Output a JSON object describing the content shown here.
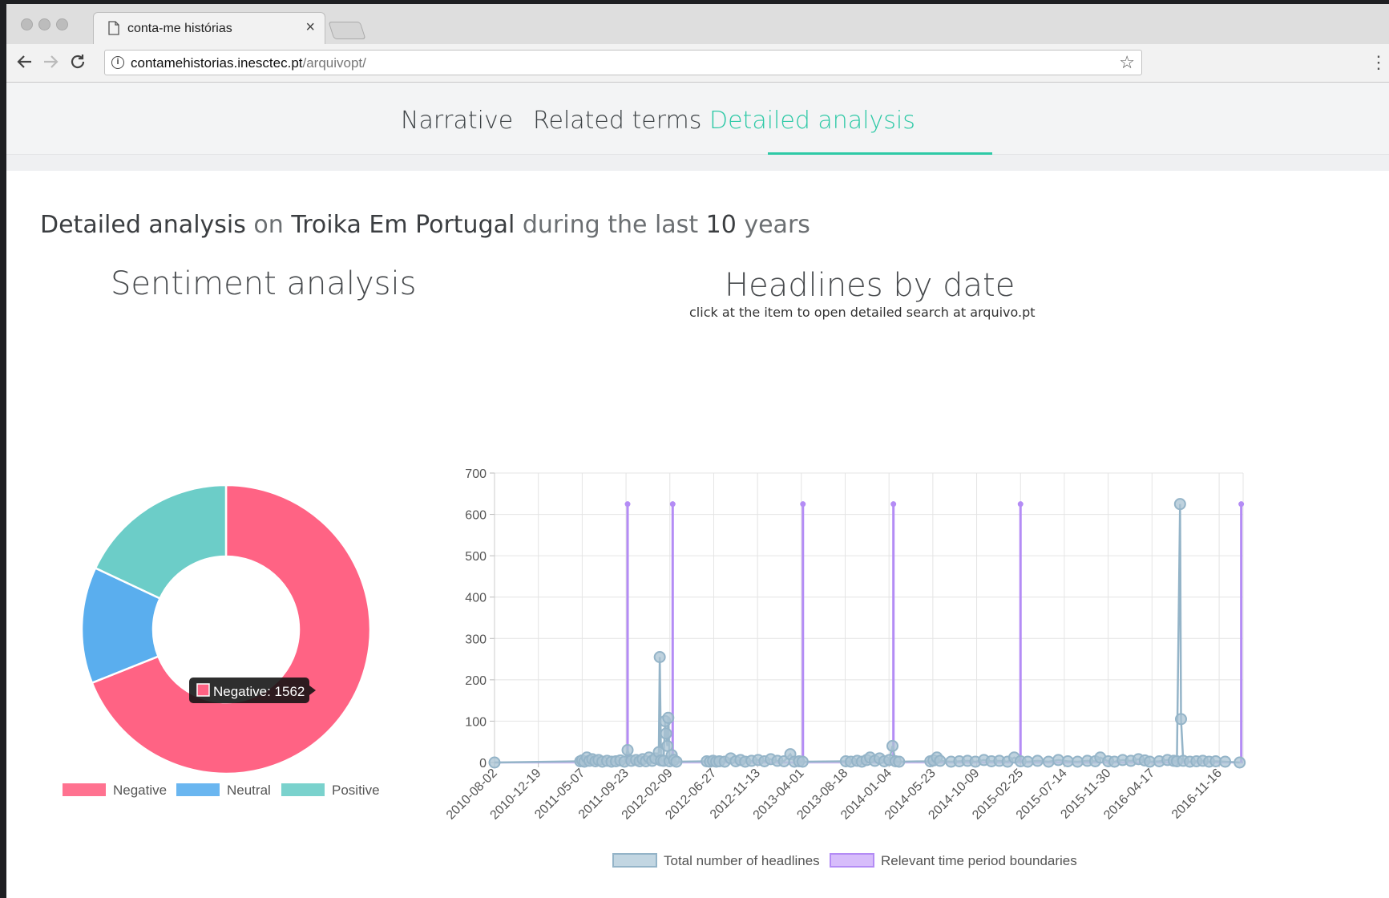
{
  "browser": {
    "tab_title": "conta-me histórias",
    "close_glyph": "×",
    "url_host": "contamehistorias.inesctec.pt",
    "url_path": "/arquivopt/"
  },
  "nav": {
    "tabs": [
      {
        "label": "Narrative",
        "active": false
      },
      {
        "label": "Related terms",
        "active": false
      },
      {
        "label": "Detailed analysis",
        "active": true
      }
    ],
    "active_color": "#2ec9a6"
  },
  "summary": {
    "p1": "Detailed analysis",
    "p2": " on ",
    "p3": "Troika Em Portugal",
    "p4": " during the last ",
    "p5": "10",
    "p6": " years"
  },
  "sentiment": {
    "title": "Sentiment analysis",
    "tooltip": "Negative: 1562",
    "chart_data": {
      "type": "pie",
      "donut": true,
      "labels": [
        "Negative",
        "Neutral",
        "Positive"
      ],
      "values": [
        1562,
        295,
        408
      ],
      "colors": [
        "#ff6384",
        "#5aaeee",
        "#6ccdc8"
      ],
      "legend_position": "bottom"
    }
  },
  "headlines": {
    "title": "Headlines by date",
    "subtitle": "click at the item to open detailed search at arquivo.pt",
    "chart_data": {
      "type": "line",
      "ylim": [
        0,
        700
      ],
      "yticks": [
        0,
        100,
        200,
        300,
        400,
        500,
        600,
        700
      ],
      "xlim": [
        "2010-08-02",
        "2017-01-31"
      ],
      "xticks": [
        "2010-08-02",
        "2010-12-19",
        "2011-05-07",
        "2011-09-23",
        "2012-02-09",
        "2012-06-27",
        "2012-11-13",
        "2013-04-01",
        "2013-08-18",
        "2014-01-04",
        "2014-05-23",
        "2014-10-09",
        "2015-02-25",
        "2015-07-14",
        "2015-11-30",
        "2016-04-17",
        "2016-11-16"
      ],
      "grid": true,
      "legend_position": "bottom",
      "series": [
        {
          "name": "Total number of headlines",
          "color": "#94b4c8",
          "points": [
            [
              "2010-08-02",
              0
            ],
            [
              "2011-05-01",
              3
            ],
            [
              "2011-05-07",
              5
            ],
            [
              "2011-05-14",
              2
            ],
            [
              "2011-05-22",
              12
            ],
            [
              "2011-05-30",
              4
            ],
            [
              "2011-06-08",
              8
            ],
            [
              "2011-06-18",
              3
            ],
            [
              "2011-06-28",
              6
            ],
            [
              "2011-07-10",
              2
            ],
            [
              "2011-07-25",
              4
            ],
            [
              "2011-08-08",
              2
            ],
            [
              "2011-08-22",
              3
            ],
            [
              "2011-09-05",
              5
            ],
            [
              "2011-09-18",
              2
            ],
            [
              "2011-09-28",
              30
            ],
            [
              "2011-10-10",
              4
            ],
            [
              "2011-10-25",
              6
            ],
            [
              "2011-11-05",
              3
            ],
            [
              "2011-11-15",
              8
            ],
            [
              "2011-11-25",
              3
            ],
            [
              "2011-12-05",
              12
            ],
            [
              "2011-12-15",
              4
            ],
            [
              "2011-12-25",
              10
            ],
            [
              "2012-01-05",
              25
            ],
            [
              "2012-01-08",
              255
            ],
            [
              "2012-01-12",
              5
            ],
            [
              "2012-01-20",
              4
            ],
            [
              "2012-01-25",
              100
            ],
            [
              "2012-01-28",
              70
            ],
            [
              "2012-02-01",
              40
            ],
            [
              "2012-02-04",
              108
            ],
            [
              "2012-02-08",
              3
            ],
            [
              "2012-02-15",
              18
            ],
            [
              "2012-02-22",
              6
            ],
            [
              "2012-03-01",
              2
            ],
            [
              "2012-06-05",
              3
            ],
            [
              "2012-06-15",
              2
            ],
            [
              "2012-06-25",
              4
            ],
            [
              "2012-07-05",
              2
            ],
            [
              "2012-07-15",
              3
            ],
            [
              "2012-08-01",
              2
            ],
            [
              "2012-08-20",
              10
            ],
            [
              "2012-09-05",
              3
            ],
            [
              "2012-09-20",
              6
            ],
            [
              "2012-10-05",
              2
            ],
            [
              "2012-10-25",
              4
            ],
            [
              "2012-11-15",
              6
            ],
            [
              "2012-12-05",
              3
            ],
            [
              "2012-12-25",
              8
            ],
            [
              "2013-01-15",
              4
            ],
            [
              "2013-02-05",
              3
            ],
            [
              "2013-02-25",
              20
            ],
            [
              "2013-03-10",
              2
            ],
            [
              "2013-03-25",
              3
            ],
            [
              "2013-04-05",
              2
            ],
            [
              "2013-08-20",
              3
            ],
            [
              "2013-09-05",
              2
            ],
            [
              "2013-09-25",
              4
            ],
            [
              "2013-10-10",
              2
            ],
            [
              "2013-10-25",
              6
            ],
            [
              "2013-11-05",
              12
            ],
            [
              "2013-11-20",
              4
            ],
            [
              "2013-12-05",
              10
            ],
            [
              "2013-12-20",
              3
            ],
            [
              "2014-01-05",
              6
            ],
            [
              "2014-01-15",
              40
            ],
            [
              "2014-01-25",
              3
            ],
            [
              "2014-02-05",
              2
            ],
            [
              "2014-05-15",
              3
            ],
            [
              "2014-05-25",
              5
            ],
            [
              "2014-06-05",
              12
            ],
            [
              "2014-06-15",
              4
            ],
            [
              "2014-07-20",
              2
            ],
            [
              "2014-08-15",
              3
            ],
            [
              "2014-09-10",
              4
            ],
            [
              "2014-10-05",
              2
            ],
            [
              "2014-11-01",
              6
            ],
            [
              "2014-11-25",
              3
            ],
            [
              "2014-12-20",
              4
            ],
            [
              "2015-01-15",
              2
            ],
            [
              "2015-02-05",
              12
            ],
            [
              "2015-02-25",
              3
            ],
            [
              "2015-03-20",
              2
            ],
            [
              "2015-04-20",
              4
            ],
            [
              "2015-05-25",
              2
            ],
            [
              "2015-06-25",
              6
            ],
            [
              "2015-07-25",
              3
            ],
            [
              "2015-08-25",
              2
            ],
            [
              "2015-09-25",
              4
            ],
            [
              "2015-10-20",
              3
            ],
            [
              "2015-11-05",
              12
            ],
            [
              "2015-11-30",
              3
            ],
            [
              "2015-12-20",
              2
            ],
            [
              "2016-01-15",
              6
            ],
            [
              "2016-02-10",
              4
            ],
            [
              "2016-03-05",
              8
            ],
            [
              "2016-03-25",
              5
            ],
            [
              "2016-04-10",
              2
            ],
            [
              "2016-05-10",
              3
            ],
            [
              "2016-06-05",
              6
            ],
            [
              "2016-06-25",
              4
            ],
            [
              "2016-07-05",
              3
            ],
            [
              "2016-07-15",
              625
            ],
            [
              "2016-07-18",
              105
            ],
            [
              "2016-07-25",
              4
            ],
            [
              "2016-08-15",
              2
            ],
            [
              "2016-09-05",
              3
            ],
            [
              "2016-09-25",
              4
            ],
            [
              "2016-10-15",
              2
            ],
            [
              "2016-11-05",
              3
            ],
            [
              "2016-12-05",
              2
            ],
            [
              "2017-01-20",
              0
            ]
          ]
        },
        {
          "name": "Relevant time period boundaries",
          "color": "#b48cf5",
          "spikes_value": 625,
          "dates": [
            "2011-09-28",
            "2012-02-18",
            "2013-04-06",
            "2014-01-18",
            "2015-02-25",
            "2017-01-25"
          ]
        }
      ]
    }
  }
}
